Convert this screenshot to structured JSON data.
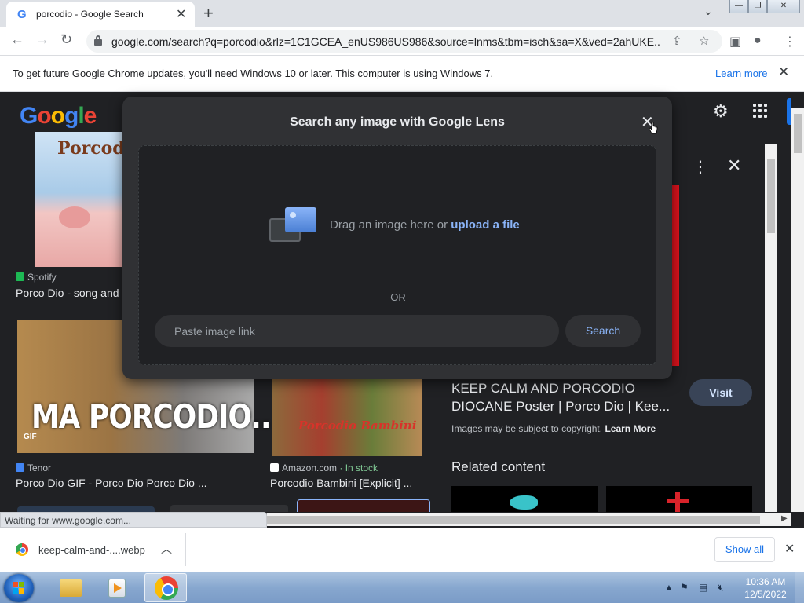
{
  "browser": {
    "tab_title": "porcodio - Google Search",
    "tab_favicon": "G",
    "tab_close": "✕",
    "new_tab": "+",
    "tab_dropdown": "⌄",
    "url": "google.com/search?q=porcodio&rlz=1C1GCEA_enUS986US986&source=lnms&tbm=isch&sa=X&ved=2ahUKE...",
    "icons": [
      "back-icon",
      "forward-icon",
      "reload-icon",
      "lock-icon",
      "share-icon",
      "star-icon",
      "side-panel-icon",
      "profile-icon",
      "menu-icon"
    ]
  },
  "infobar": {
    "message": "To get future Google Chrome updates, you'll need Windows 10 or later. This computer is using Windows 7.",
    "learn_more": "Learn more"
  },
  "google": {
    "logo": [
      "G",
      "o",
      "o",
      "g",
      "l",
      "e"
    ]
  },
  "results": [
    {
      "source": "Spotify",
      "title": "Porco Dio - song and",
      "thumb_text": "Porcod",
      "source_color": "#1db954"
    },
    {
      "source": "Tenor",
      "title": "Porco Dio GIF - Porco Dio Porco Dio ...",
      "thumb_text": "MA PORCODIO..",
      "badge": "GIF",
      "source_color": "#4285f4"
    },
    {
      "source": "Amazon.com",
      "stock": " · In stock",
      "title": "Porcodio Bambini [Explicit] ...",
      "thumb_text": "Porcodio Bambini",
      "source_color": "#ffffff"
    }
  ],
  "side_panel": {
    "title": "KEEP CALM AND PORCODIO DIOCANE Poster | Porco Dio | Kee...",
    "visit": "Visit",
    "copyright": "Images may be subject to copyright. ",
    "copyright_link": "Learn More",
    "related": "Related content"
  },
  "lens": {
    "title": "Search any image with Google Lens",
    "drag_text": "Drag an image here or ",
    "upload_link": "upload a file",
    "or": "OR",
    "paste_placeholder": "Paste image link",
    "search_button": "Search"
  },
  "status": "Waiting for www.google.com...",
  "download": {
    "file": "keep-calm-and-....webp",
    "show_all": "Show all"
  },
  "taskbar": {
    "time": "10:36 AM",
    "date": "12/5/2022",
    "apps": [
      "windows-explorer",
      "windows-media-player",
      "google-chrome"
    ]
  }
}
